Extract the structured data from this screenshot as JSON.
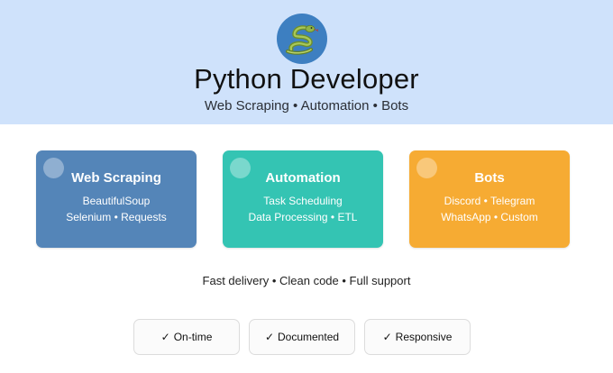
{
  "hero": {
    "icon": "python-snake-icon",
    "title": "Python Developer",
    "subtitle": "Web Scraping • Automation • Bots",
    "background": "#cfe2fb",
    "logo_bg": "#3d7fc1"
  },
  "cards": [
    {
      "title": "Web Scraping",
      "line1": "BeautifulSoup",
      "line2": "Selenium • Requests",
      "color": "#5485b8"
    },
    {
      "title": "Automation",
      "line1": "Task Scheduling",
      "line2": "Data Processing • ETL",
      "color": "#34c4b3"
    },
    {
      "title": "Bots",
      "line1": "Discord • Telegram",
      "line2": "WhatsApp • Custom",
      "color": "#f6ab33"
    }
  ],
  "tagline": "Fast delivery • Clean code • Full support",
  "badges": [
    {
      "check": "✓",
      "label": "On-time"
    },
    {
      "check": "✓",
      "label": "Documented"
    },
    {
      "check": "✓",
      "label": "Responsive"
    }
  ]
}
